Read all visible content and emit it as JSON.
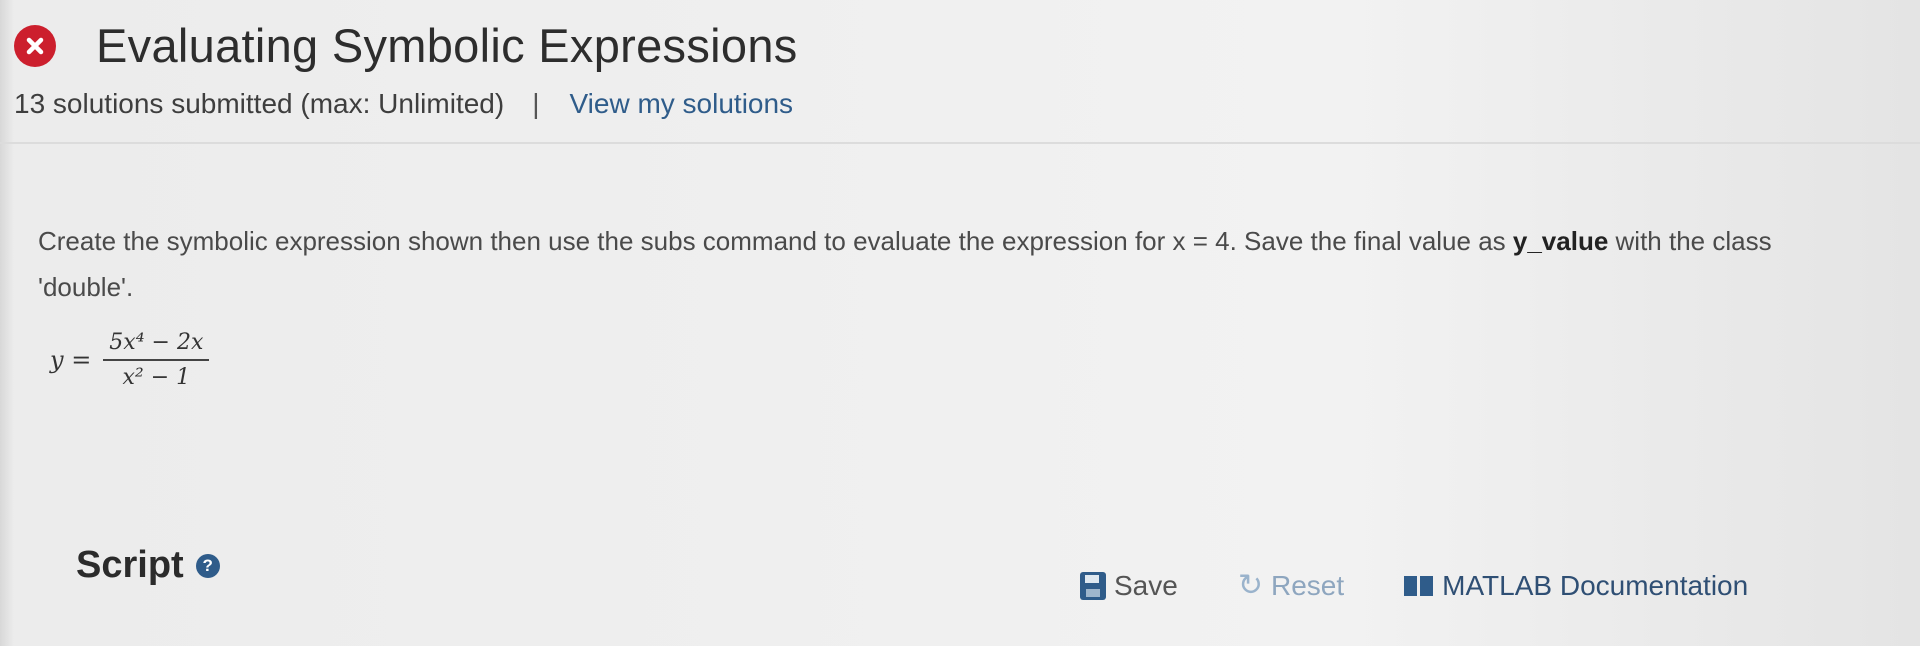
{
  "header": {
    "status_icon": "error-x-icon",
    "status_color": "#cc1f2d",
    "title": "Evaluating Symbolic Expressions"
  },
  "meta": {
    "submissions": "13 solutions submitted (max: Unlimited)",
    "separator": "|",
    "view_link": "View my solutions"
  },
  "problem": {
    "text_before": "Create the symbolic expression shown then use the subs command to evaluate the expression for x = 4. Save the final value as ",
    "variable": "y_value",
    "text_after": " with the class 'double'."
  },
  "equation": {
    "lhs": "y =",
    "numerator": "5x⁴ − 2x",
    "denominator": "x² − 1"
  },
  "script": {
    "label": "Script",
    "help_icon": "question-circle-icon",
    "help_glyph": "?"
  },
  "toolbar": {
    "save_label": "Save",
    "save_icon": "floppy-disk-icon",
    "reset_label": "Reset",
    "reset_icon": "refresh-icon",
    "doc_label": "MATLAB Documentation",
    "doc_icon": "book-icon"
  }
}
